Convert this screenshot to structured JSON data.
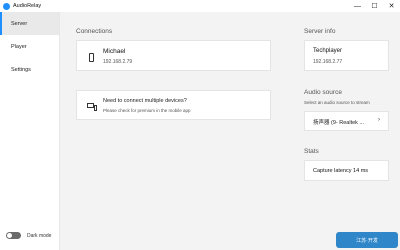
{
  "window": {
    "title": "AudioRelay",
    "minimize": "—",
    "maximize": "☐",
    "close": "✕"
  },
  "sidebar": {
    "items": [
      {
        "label": "Server"
      },
      {
        "label": "Player"
      },
      {
        "label": "Settings"
      }
    ],
    "dark_mode_label": "Dark mode"
  },
  "connections": {
    "title": "Connections",
    "device": {
      "name": "Michael",
      "ip": "192.168.2.79"
    },
    "multi": {
      "title": "Need to connect multiple devices?",
      "subtitle": "Please check for premium in the mobile app"
    }
  },
  "server_info": {
    "title": "Server info",
    "name": "Techplayer",
    "ip": "192.168.2.77"
  },
  "audio_source": {
    "title": "Audio source",
    "hint": "Select an audio source to stream",
    "selected": "扬声器 (9- Realtek ..."
  },
  "stats": {
    "title": "Stats",
    "capture_latency": "Capture latency 14 ms"
  },
  "watermark": {
    "text": "江苏·开发"
  }
}
